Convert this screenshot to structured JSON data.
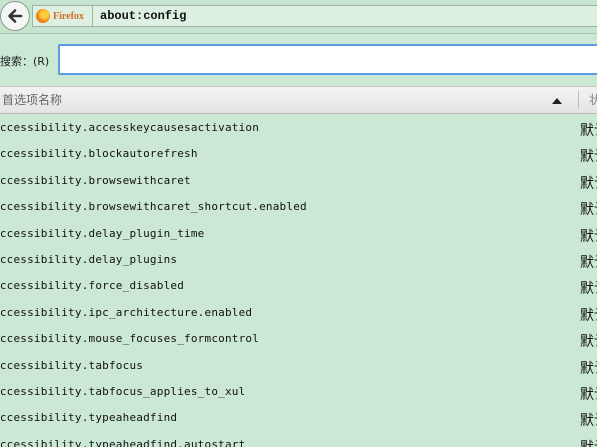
{
  "navbar": {
    "identity_label": "Firefox",
    "url": "about:config"
  },
  "search": {
    "label": "搜索：(R)",
    "value": "",
    "placeholder": ""
  },
  "table": {
    "columns": [
      "首选项名称",
      "状态"
    ],
    "sort_direction": "ascending",
    "rows": [
      {
        "name": "accessibility.accesskeycausesactivation",
        "status": "默认"
      },
      {
        "name": "accessibility.blockautorefresh",
        "status": "默认"
      },
      {
        "name": "accessibility.browsewithcaret",
        "status": "默认"
      },
      {
        "name": "accessibility.browsewithcaret_shortcut.enabled",
        "status": "默认"
      },
      {
        "name": "accessibility.delay_plugin_time",
        "status": "默认"
      },
      {
        "name": "accessibility.delay_plugins",
        "status": "默认"
      },
      {
        "name": "accessibility.force_disabled",
        "status": "默认"
      },
      {
        "name": "accessibility.ipc_architecture.enabled",
        "status": "默认"
      },
      {
        "name": "accessibility.mouse_focuses_formcontrol",
        "status": "默认"
      },
      {
        "name": "accessibility.tabfocus",
        "status": "默认"
      },
      {
        "name": "accessibility.tabfocus_applies_to_xul",
        "status": "默认"
      },
      {
        "name": "accessibility.typeaheadfind",
        "status": "默认"
      },
      {
        "name": "accessibility.typeaheadfind.autostart",
        "status": "默认"
      }
    ]
  },
  "colors": {
    "background": "#cbe8d4",
    "input_border": "#5b9be0",
    "identity_text": "#d06e21"
  }
}
